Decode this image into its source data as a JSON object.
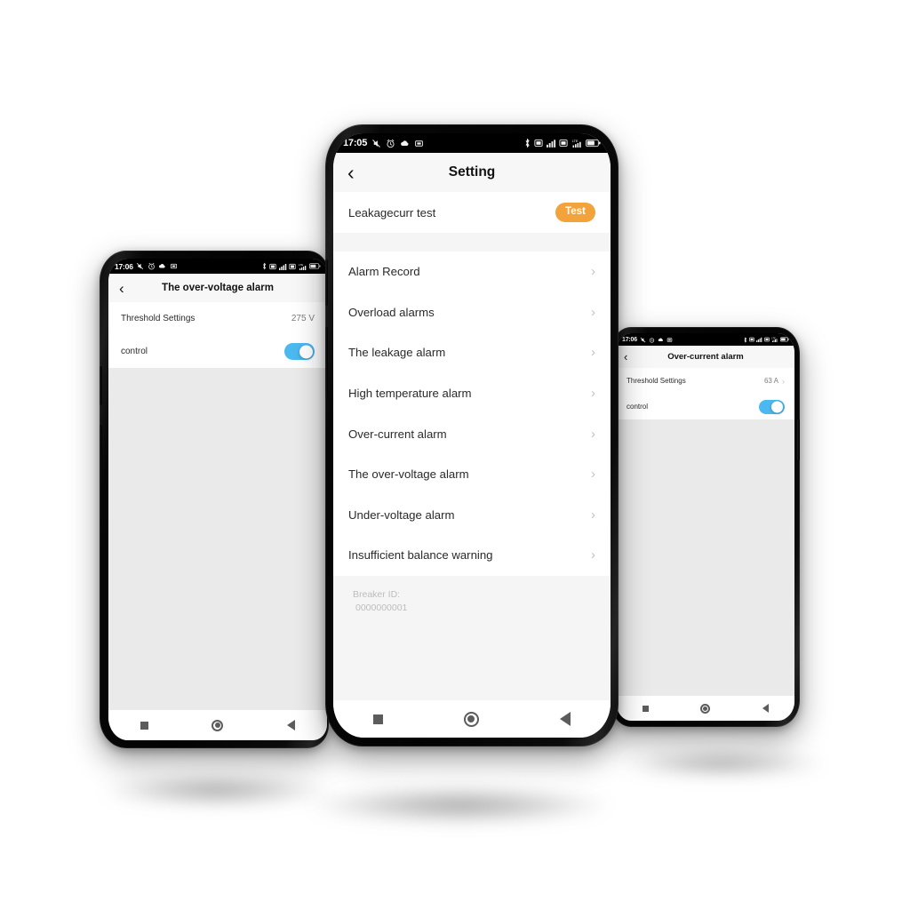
{
  "app": {
    "accent_orange": "#F2A33C",
    "toggle_on_color": "#4CB8F0",
    "background": "#FFFFFF"
  },
  "phones": {
    "left": {
      "status_bar": {
        "time": "17:06",
        "left_icons": [
          "silent-mode-icon",
          "alarm-clock-icon",
          "cloud-icon",
          "sim-card-icon"
        ],
        "right_icons": [
          "bluetooth-icon",
          "sim1-signal-icon",
          "signal-bars-icon",
          "sim2-signal-icon",
          "lte-signal-icon",
          "battery-icon"
        ]
      },
      "header": {
        "back_label": "‹",
        "title": "The over-voltage alarm"
      },
      "rows": [
        {
          "label": "Threshold Settings",
          "value": "275 V",
          "type": "value"
        },
        {
          "label": "control",
          "value": "",
          "type": "toggle",
          "toggle_on": true
        }
      ],
      "nav_bar": {
        "recents": "recents-square",
        "home": "home-circle",
        "back": "back-triangle"
      }
    },
    "center": {
      "status_bar": {
        "time": "17:05",
        "left_icons": [
          "silent-mode-icon",
          "alarm-clock-icon",
          "cloud-icon",
          "sim-card-icon"
        ],
        "right_icons": [
          "bluetooth-icon",
          "sim1-signal-icon",
          "signal-bars-icon",
          "sim2-signal-icon",
          "lte-signal-icon",
          "battery-icon"
        ],
        "battery_text": "53"
      },
      "header": {
        "back_label": "‹",
        "title": "Setting"
      },
      "test_row": {
        "label": "Leakagecurr test",
        "button_label": "Test"
      },
      "menu_items": [
        {
          "label": "Alarm Record",
          "chevron": "›"
        },
        {
          "label": "Overload alarms",
          "chevron": "›"
        },
        {
          "label": "The leakage alarm",
          "chevron": "›"
        },
        {
          "label": "High temperature alarm",
          "chevron": "›"
        },
        {
          "label": "Over-current alarm",
          "chevron": "›"
        },
        {
          "label": "The over-voltage alarm",
          "chevron": "›"
        },
        {
          "label": "Under-voltage alarm",
          "chevron": "›"
        },
        {
          "label": "Insufficient balance warning",
          "chevron": "›"
        }
      ],
      "footer": {
        "breaker_id_label": "Breaker ID:",
        "breaker_id_value": "0000000001"
      },
      "nav_bar": {
        "recents": "recents-square",
        "home": "home-circle",
        "back": "back-triangle"
      }
    },
    "right": {
      "status_bar": {
        "time": "17:06",
        "left_icons": [
          "silent-mode-icon",
          "alarm-clock-icon",
          "cloud-icon",
          "sim-card-icon"
        ],
        "right_icons": [
          "bluetooth-icon",
          "sim1-signal-icon",
          "signal-bars-icon",
          "sim2-signal-icon",
          "lte-signal-icon",
          "battery-icon"
        ]
      },
      "header": {
        "back_label": "‹",
        "title": "Over-current alarm"
      },
      "rows": [
        {
          "label": "Threshold Settings",
          "value": "63 A",
          "chevron": "›",
          "type": "value"
        },
        {
          "label": "control",
          "value": "",
          "type": "toggle",
          "toggle_on": true
        }
      ],
      "nav_bar": {
        "recents": "recents-square",
        "home": "home-circle",
        "back": "back-triangle"
      }
    }
  }
}
